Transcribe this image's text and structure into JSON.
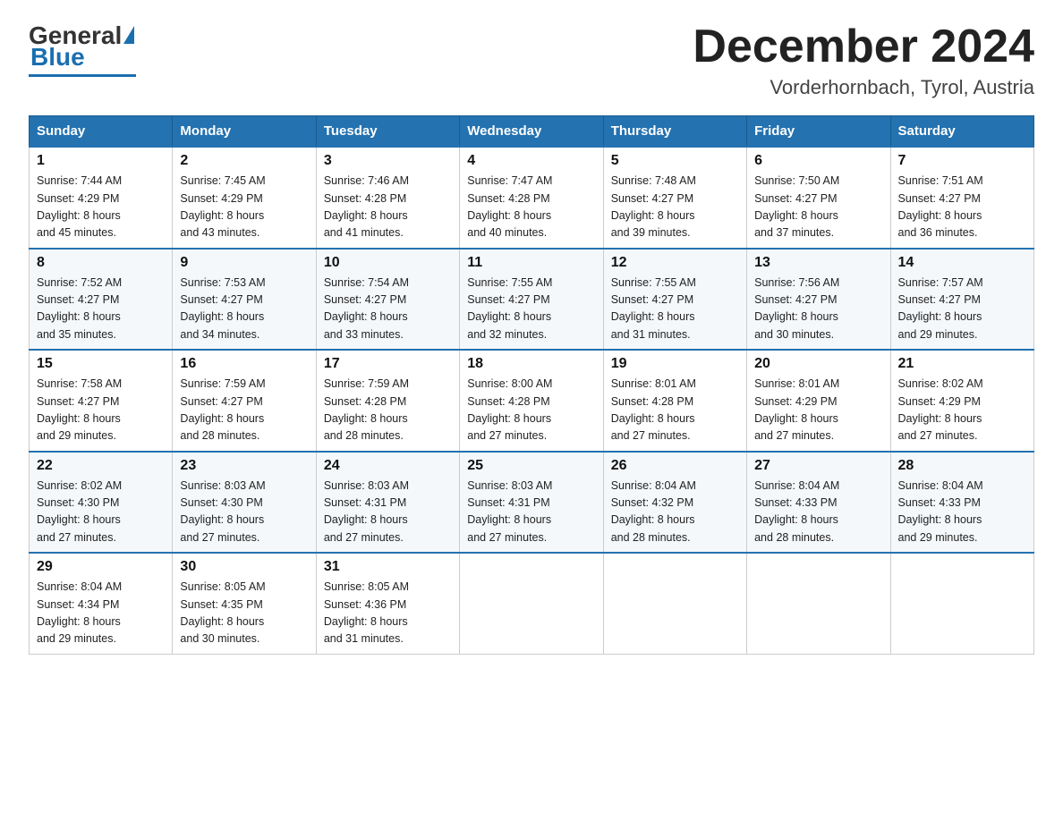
{
  "logo": {
    "general": "General",
    "blue": "Blue",
    "tagline": ""
  },
  "header": {
    "title": "December 2024",
    "location": "Vorderhornbach, Tyrol, Austria"
  },
  "days_of_week": [
    "Sunday",
    "Monday",
    "Tuesday",
    "Wednesday",
    "Thursday",
    "Friday",
    "Saturday"
  ],
  "weeks": [
    [
      {
        "day": 1,
        "sunrise": "7:44 AM",
        "sunset": "4:29 PM",
        "daylight": "8 hours and 45 minutes."
      },
      {
        "day": 2,
        "sunrise": "7:45 AM",
        "sunset": "4:29 PM",
        "daylight": "8 hours and 43 minutes."
      },
      {
        "day": 3,
        "sunrise": "7:46 AM",
        "sunset": "4:28 PM",
        "daylight": "8 hours and 41 minutes."
      },
      {
        "day": 4,
        "sunrise": "7:47 AM",
        "sunset": "4:28 PM",
        "daylight": "8 hours and 40 minutes."
      },
      {
        "day": 5,
        "sunrise": "7:48 AM",
        "sunset": "4:27 PM",
        "daylight": "8 hours and 39 minutes."
      },
      {
        "day": 6,
        "sunrise": "7:50 AM",
        "sunset": "4:27 PM",
        "daylight": "8 hours and 37 minutes."
      },
      {
        "day": 7,
        "sunrise": "7:51 AM",
        "sunset": "4:27 PM",
        "daylight": "8 hours and 36 minutes."
      }
    ],
    [
      {
        "day": 8,
        "sunrise": "7:52 AM",
        "sunset": "4:27 PM",
        "daylight": "8 hours and 35 minutes."
      },
      {
        "day": 9,
        "sunrise": "7:53 AM",
        "sunset": "4:27 PM",
        "daylight": "8 hours and 34 minutes."
      },
      {
        "day": 10,
        "sunrise": "7:54 AM",
        "sunset": "4:27 PM",
        "daylight": "8 hours and 33 minutes."
      },
      {
        "day": 11,
        "sunrise": "7:55 AM",
        "sunset": "4:27 PM",
        "daylight": "8 hours and 32 minutes."
      },
      {
        "day": 12,
        "sunrise": "7:55 AM",
        "sunset": "4:27 PM",
        "daylight": "8 hours and 31 minutes."
      },
      {
        "day": 13,
        "sunrise": "7:56 AM",
        "sunset": "4:27 PM",
        "daylight": "8 hours and 30 minutes."
      },
      {
        "day": 14,
        "sunrise": "7:57 AM",
        "sunset": "4:27 PM",
        "daylight": "8 hours and 29 minutes."
      }
    ],
    [
      {
        "day": 15,
        "sunrise": "7:58 AM",
        "sunset": "4:27 PM",
        "daylight": "8 hours and 29 minutes."
      },
      {
        "day": 16,
        "sunrise": "7:59 AM",
        "sunset": "4:27 PM",
        "daylight": "8 hours and 28 minutes."
      },
      {
        "day": 17,
        "sunrise": "7:59 AM",
        "sunset": "4:28 PM",
        "daylight": "8 hours and 28 minutes."
      },
      {
        "day": 18,
        "sunrise": "8:00 AM",
        "sunset": "4:28 PM",
        "daylight": "8 hours and 27 minutes."
      },
      {
        "day": 19,
        "sunrise": "8:01 AM",
        "sunset": "4:28 PM",
        "daylight": "8 hours and 27 minutes."
      },
      {
        "day": 20,
        "sunrise": "8:01 AM",
        "sunset": "4:29 PM",
        "daylight": "8 hours and 27 minutes."
      },
      {
        "day": 21,
        "sunrise": "8:02 AM",
        "sunset": "4:29 PM",
        "daylight": "8 hours and 27 minutes."
      }
    ],
    [
      {
        "day": 22,
        "sunrise": "8:02 AM",
        "sunset": "4:30 PM",
        "daylight": "8 hours and 27 minutes."
      },
      {
        "day": 23,
        "sunrise": "8:03 AM",
        "sunset": "4:30 PM",
        "daylight": "8 hours and 27 minutes."
      },
      {
        "day": 24,
        "sunrise": "8:03 AM",
        "sunset": "4:31 PM",
        "daylight": "8 hours and 27 minutes."
      },
      {
        "day": 25,
        "sunrise": "8:03 AM",
        "sunset": "4:31 PM",
        "daylight": "8 hours and 27 minutes."
      },
      {
        "day": 26,
        "sunrise": "8:04 AM",
        "sunset": "4:32 PM",
        "daylight": "8 hours and 28 minutes."
      },
      {
        "day": 27,
        "sunrise": "8:04 AM",
        "sunset": "4:33 PM",
        "daylight": "8 hours and 28 minutes."
      },
      {
        "day": 28,
        "sunrise": "8:04 AM",
        "sunset": "4:33 PM",
        "daylight": "8 hours and 29 minutes."
      }
    ],
    [
      {
        "day": 29,
        "sunrise": "8:04 AM",
        "sunset": "4:34 PM",
        "daylight": "8 hours and 29 minutes."
      },
      {
        "day": 30,
        "sunrise": "8:05 AM",
        "sunset": "4:35 PM",
        "daylight": "8 hours and 30 minutes."
      },
      {
        "day": 31,
        "sunrise": "8:05 AM",
        "sunset": "4:36 PM",
        "daylight": "8 hours and 31 minutes."
      },
      null,
      null,
      null,
      null
    ]
  ],
  "labels": {
    "sunrise": "Sunrise:",
    "sunset": "Sunset:",
    "daylight": "Daylight:"
  }
}
